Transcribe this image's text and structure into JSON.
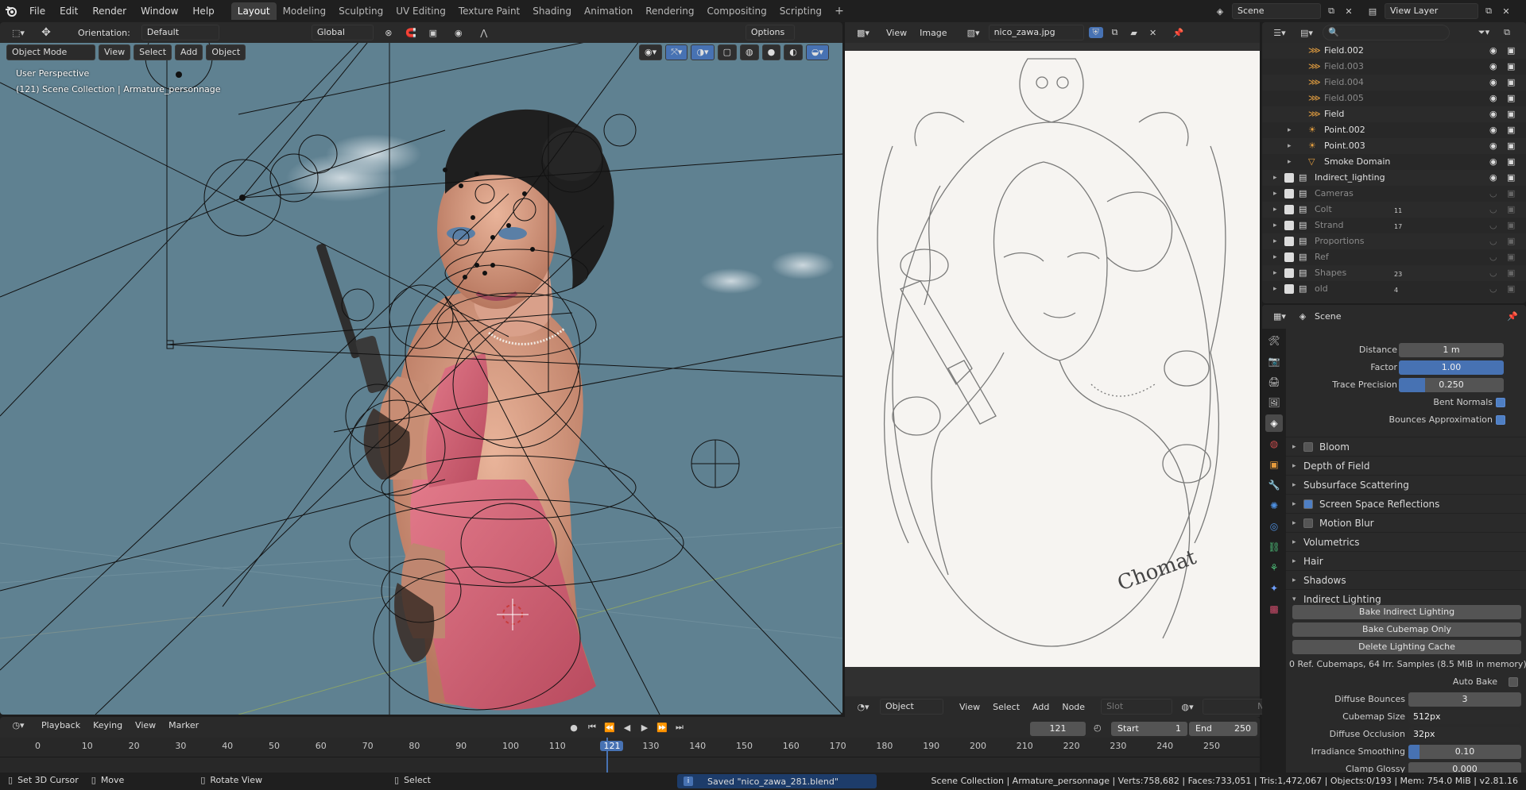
{
  "topbar": {
    "menus": [
      "File",
      "Edit",
      "Render",
      "Window",
      "Help"
    ],
    "workspaces": [
      "Layout",
      "Modeling",
      "Sculpting",
      "UV Editing",
      "Texture Paint",
      "Shading",
      "Animation",
      "Rendering",
      "Compositing",
      "Scripting"
    ],
    "active_workspace": "Layout",
    "add_tab": "+",
    "scene_name": "Scene",
    "view_layer": "View Layer"
  },
  "viewport": {
    "orientation_label": "Orientation:",
    "orientation_value": "Default",
    "mode": "Object Mode",
    "menus": [
      "View",
      "Select",
      "Add",
      "Object"
    ],
    "transform_space": "Global",
    "options": "Options",
    "overlay_line1": "User Perspective",
    "overlay_line2": "(121) Scene Collection | Armature_personnage"
  },
  "image_editor": {
    "menus": [
      "View",
      "Image"
    ],
    "image_name": "nico_zawa.jpg",
    "signature": "Chomat"
  },
  "node_editor": {
    "mode": "Object",
    "menus": [
      "View",
      "Select",
      "Add",
      "Node"
    ],
    "slot": "Slot",
    "new": "New"
  },
  "outliner": {
    "rows": [
      {
        "name": "Field.002",
        "dim": false
      },
      {
        "name": "Field.003",
        "dim": true
      },
      {
        "name": "Field.004",
        "dim": true
      },
      {
        "name": "Field.005",
        "dim": true
      },
      {
        "name": "Field",
        "dim": false
      },
      {
        "name": "Point.002",
        "dim": false
      },
      {
        "name": "Point.003",
        "dim": false
      },
      {
        "name": "Smoke Domain",
        "dim": false
      },
      {
        "name": "Indirect_lighting",
        "dim": false
      },
      {
        "name": "Cameras",
        "dim": true
      },
      {
        "name": "Colt",
        "dim": true,
        "count": "11"
      },
      {
        "name": "Strand",
        "dim": true,
        "count": "17"
      },
      {
        "name": "Proportions",
        "dim": true
      },
      {
        "name": "Ref",
        "dim": true
      },
      {
        "name": "Shapes",
        "dim": true,
        "count": "23"
      },
      {
        "name": "old",
        "dim": true,
        "count": "4"
      }
    ]
  },
  "properties": {
    "context": "Scene",
    "distance_label": "Distance",
    "distance_value": "1 m",
    "factor_label": "Factor",
    "factor_value": "1.00",
    "trace_label": "Trace Precision",
    "trace_value": "0.250",
    "trace_fill": 0.25,
    "bent_normals": "Bent Normals",
    "bounces_approx": "Bounces Approximation",
    "sections": [
      {
        "label": "Bloom",
        "checkbox": true,
        "checked": false
      },
      {
        "label": "Depth of Field",
        "checkbox": false
      },
      {
        "label": "Subsurface Scattering",
        "checkbox": false
      },
      {
        "label": "Screen Space Reflections",
        "checkbox": true,
        "checked": true
      },
      {
        "label": "Motion Blur",
        "checkbox": true,
        "checked": false
      },
      {
        "label": "Volumetrics",
        "checkbox": false
      },
      {
        "label": "Hair",
        "checkbox": false
      },
      {
        "label": "Shadows",
        "checkbox": false
      },
      {
        "label": "Indirect Lighting",
        "checkbox": false,
        "open": true
      }
    ],
    "bake_indirect": "Bake Indirect Lighting",
    "bake_cubemap": "Bake Cubemap Only",
    "delete_cache": "Delete Lighting Cache",
    "cache_info": "0 Ref. Cubemaps, 64 Irr. Samples (8.5 MiB in memory)",
    "auto_bake": "Auto Bake",
    "diffuse_bounces_label": "Diffuse Bounces",
    "diffuse_bounces_value": "3",
    "cubemap_size_label": "Cubemap Size",
    "cubemap_size_value": "512px",
    "diffuse_occlusion_label": "Diffuse Occlusion",
    "diffuse_occlusion_value": "32px",
    "irradiance_smoothing_label": "Irradiance Smoothing",
    "irradiance_smoothing_value": "0.10",
    "irradiance_fill": 0.1,
    "clamp_glossy_label": "Clamp Glossy",
    "clamp_glossy_value": "0.000"
  },
  "timeline": {
    "menus": [
      "Playback",
      "Keying",
      "View",
      "Marker"
    ],
    "current_frame": "121",
    "start_label": "Start",
    "start_value": "1",
    "end_label": "End",
    "end_value": "250",
    "ticks": [
      "0",
      "10",
      "20",
      "30",
      "40",
      "50",
      "60",
      "70",
      "80",
      "90",
      "100",
      "110",
      "121",
      "130",
      "140",
      "150",
      "160",
      "170",
      "180",
      "190",
      "200",
      "210",
      "220",
      "230",
      "240",
      "250"
    ]
  },
  "statusbar": {
    "cursor": "Set 3D Cursor",
    "move": "Move",
    "rotate": "Rotate View",
    "select": "Select",
    "message": "Saved \"nico_zawa_281.blend\"",
    "stats": "Scene Collection | Armature_personnage | Verts:758,682 | Faces:733,051 | Tris:1,472,067 | Objects:0/193 | Mem: 754.0 MiB | v2.81.16"
  },
  "colors": {
    "accent": "#4772b3",
    "viewport_bg": "#5f8191",
    "dress": "#d9677a"
  }
}
